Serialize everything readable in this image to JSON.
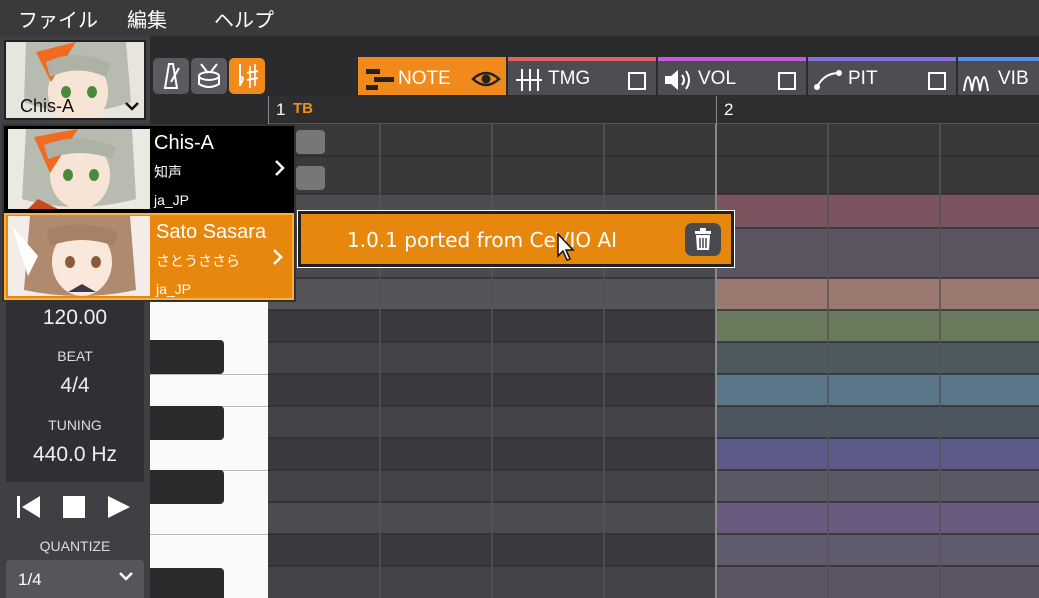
{
  "menu": [
    "ファイル",
    "編集",
    "ヘルプ"
  ],
  "singer_select": {
    "name": "Chis-A"
  },
  "toolbar": {
    "icons": [
      "metronome-icon",
      "drum-icon",
      "sharp-flat-icon"
    ],
    "active": "sharp-flat-icon"
  },
  "tabs": [
    {
      "label": "NOTE",
      "accent": "#f08a1c",
      "active": true
    },
    {
      "label": "TMG",
      "accent": "#e06060"
    },
    {
      "label": "VOL",
      "accent": "#c45ad8"
    },
    {
      "label": "PIT",
      "accent": "#8a6ee0"
    },
    {
      "label": "VIB",
      "accent": "#5a8ce8"
    }
  ],
  "ruler": {
    "measures": [
      "1",
      "2"
    ],
    "marker": "TB"
  },
  "info": {
    "tempo": "120.00",
    "beat_label": "BEAT",
    "beat": "4/4",
    "tuning_label": "TUNING",
    "tuning": "440.0 Hz"
  },
  "quantize": {
    "label": "QUANTIZE",
    "value": "1/4"
  },
  "singers": [
    {
      "name": "Chis-A",
      "sub": "知声",
      "lang": "ja_JP",
      "selected": false
    },
    {
      "name": "Sato Sasara",
      "sub": "さとうささら",
      "lang": "ja_JP",
      "selected": true
    }
  ],
  "submenu": {
    "label": "1.0.1 ported from CeVIO AI"
  },
  "colors": {
    "accent": "#f08a1c",
    "lanes": [
      "#7c5460",
      "#5a5560",
      "#5c6270",
      "#9a7a70",
      "#6a7a5c",
      "#4c5a5e",
      "#5a7688",
      "#4c5660",
      "#5c5a88",
      "#5a5864",
      "#6a5a80",
      "#605a6e"
    ]
  }
}
